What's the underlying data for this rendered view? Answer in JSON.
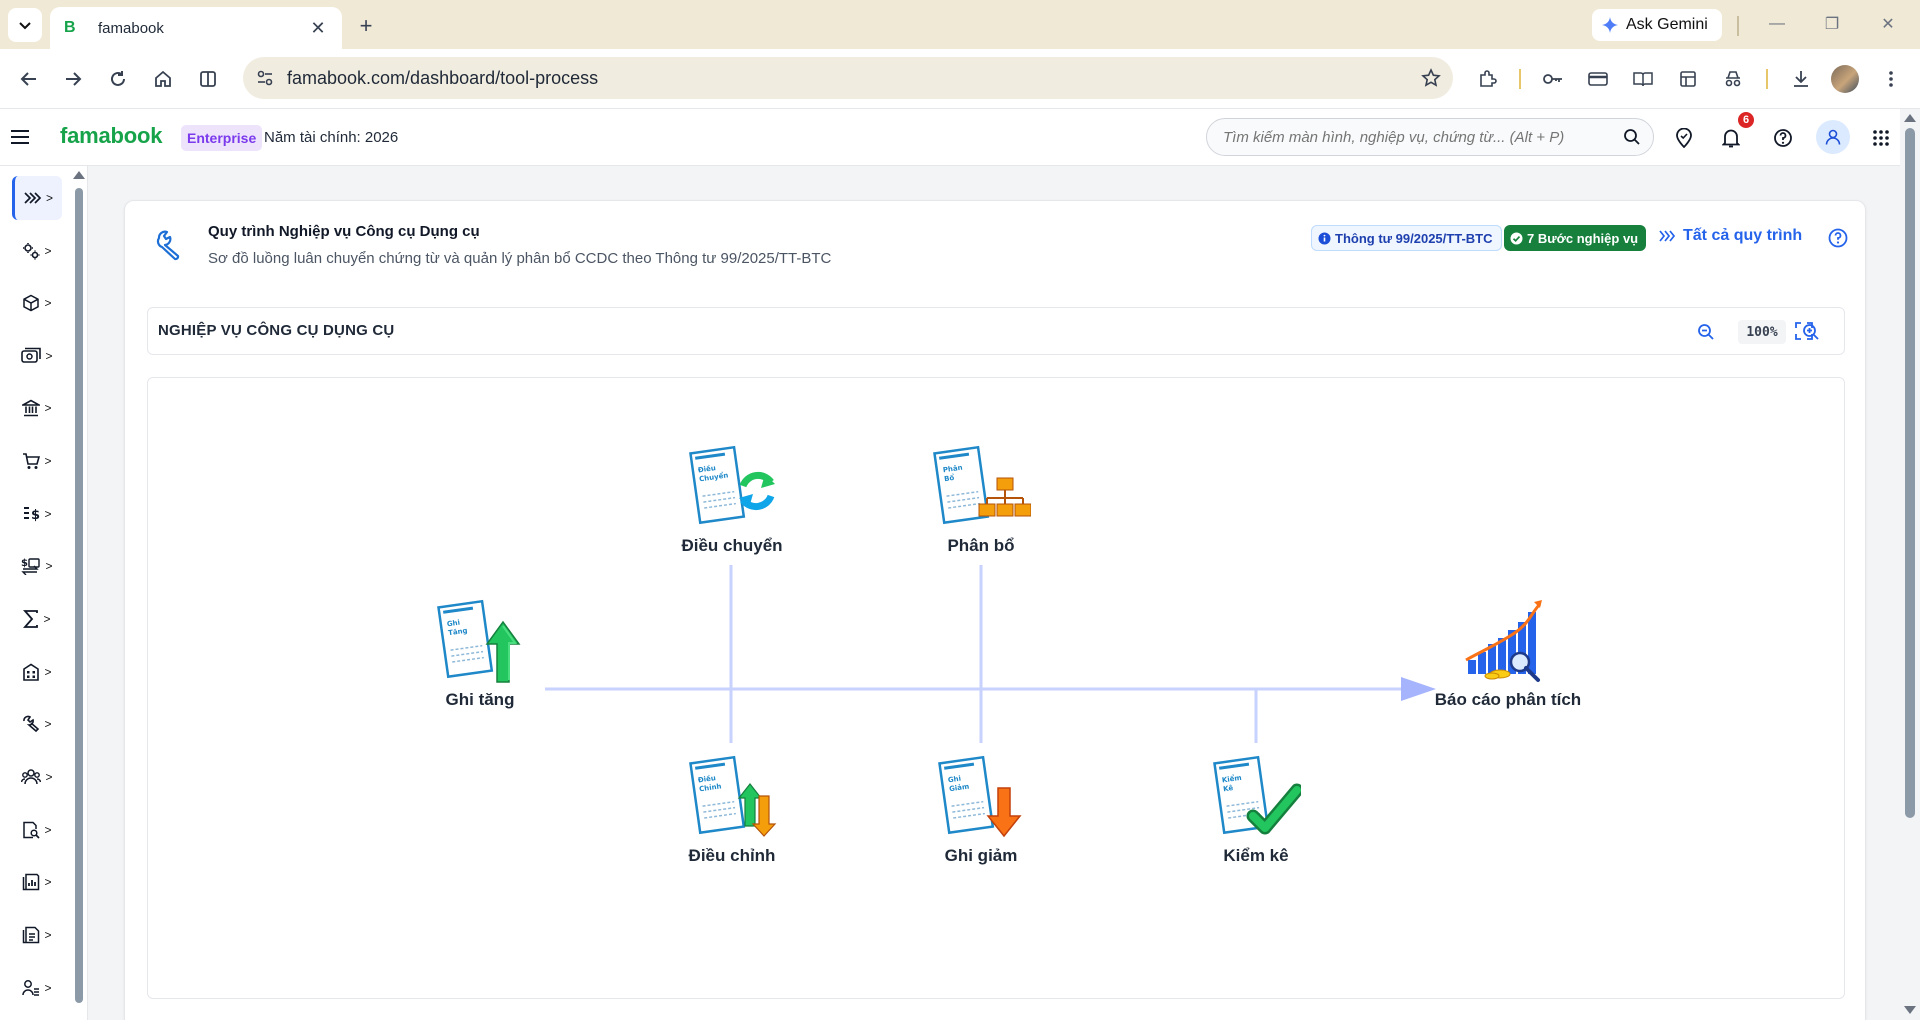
{
  "browser": {
    "tab_title": "famabook",
    "tab_favicon": "B",
    "ask_gemini": "Ask Gemini",
    "url": "famabook.com/dashboard/tool-process"
  },
  "app": {
    "brand": "famabook",
    "edition": "Enterprise",
    "fiscal_year": "Năm tài chính: 2026",
    "search_placeholder": "Tìm kiếm màn hình, nghiệp vụ, chứng từ... (Alt + P)",
    "notification_count": "6"
  },
  "sidebar": {
    "items": [
      {
        "icon": "expand-arrows-icon",
        "active": true
      },
      {
        "icon": "settings-gears-icon"
      },
      {
        "icon": "box-icon"
      },
      {
        "icon": "cash-icon"
      },
      {
        "icon": "bank-icon"
      },
      {
        "icon": "cart-icon"
      },
      {
        "icon": "price-list-icon"
      },
      {
        "icon": "money-exchange-icon"
      },
      {
        "icon": "sigma-icon"
      },
      {
        "icon": "building-icon"
      },
      {
        "icon": "tools-icon"
      },
      {
        "icon": "team-icon"
      },
      {
        "icon": "document-search-icon"
      },
      {
        "icon": "report-chart-icon"
      },
      {
        "icon": "documents-icon"
      },
      {
        "icon": "user-list-icon"
      }
    ]
  },
  "card": {
    "title": "Quy trình Nghiệp vụ Công cụ Dụng cụ",
    "subtitle": "Sơ đồ luồng luân chuyển chứng từ và quản lý phân bổ CCDC theo Thông tư 99/2025/TT-BTC",
    "badge_regulation": "Thông tư 99/2025/TT-BTC",
    "badge_steps": "7 Bước nghiệp vụ",
    "all_processes": "Tất cả quy trình"
  },
  "diagram": {
    "title": "NGHIỆP VỤ CÔNG CỤ DỤNG CỤ",
    "zoom": "100%",
    "nodes": {
      "ghi_tang": {
        "label": "Ghi tăng",
        "doc_text": [
          "Ghi",
          "Tăng"
        ]
      },
      "dieu_chuyen": {
        "label": "Điều chuyển",
        "doc_text": [
          "Điều",
          "Chuyển"
        ]
      },
      "phan_bo": {
        "label": "Phân bổ",
        "doc_text": [
          "Phân",
          "Bổ"
        ]
      },
      "dieu_chinh": {
        "label": "Điều chỉnh",
        "doc_text": [
          "Điều",
          "Chỉnh"
        ]
      },
      "ghi_giam": {
        "label": "Ghi giảm",
        "doc_text": [
          "Ghi",
          "Giảm"
        ]
      },
      "kiem_ke": {
        "label": "Kiểm kê",
        "doc_text": [
          "Kiểm",
          "Kê"
        ]
      },
      "bao_cao": {
        "label": "Báo cáo phân tích"
      }
    },
    "colors": {
      "line": "#c7d2fe",
      "arrow": "#a5b4fc",
      "doc_stroke": "#1e88c8",
      "green": "#22c55e",
      "orange": "#f97316",
      "bar_blue": "#2563eb"
    }
  }
}
